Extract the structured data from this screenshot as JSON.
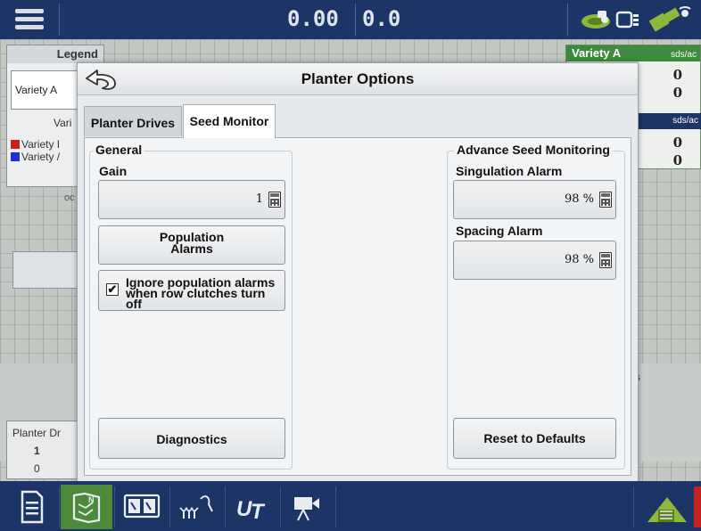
{
  "topbar": {
    "readout_left": "0.00",
    "readout_right": "0.0",
    "icons": [
      "menu-icon",
      "field-tractor-icon",
      "connection-icon",
      "gps-satellite-icon"
    ]
  },
  "background": {
    "legend": {
      "title": "Legend",
      "button_label": "Variety A",
      "subtitle": "Vari",
      "rows": [
        {
          "label": "Variety I",
          "color": "#c42121"
        },
        {
          "label": "Variety /",
          "color": "#1d2fd4"
        }
      ],
      "small_text": "oc"
    },
    "variety_panel": {
      "title": "Variety A",
      "unit": "sds/ac",
      "values": [
        "0",
        "0"
      ],
      "unit2": "sds/ac",
      "values2": [
        "0",
        "0"
      ]
    },
    "right_fragment": "s",
    "planter_drives_panel": {
      "title": "Planter Dr",
      "value": "1",
      "subvalue": "0"
    }
  },
  "modal": {
    "title": "Planter Options",
    "tabs": [
      {
        "label": "Planter Drives",
        "active": false
      },
      {
        "label": "Seed Monitor",
        "active": true
      }
    ],
    "general": {
      "legend": "General",
      "gain_label": "Gain",
      "gain_value": "1",
      "population_alarms_line1": "Population",
      "population_alarms_line2": "Alarms",
      "ignore_checked": true,
      "ignore_label": "Ignore population alarms when row clutches turn off",
      "diagnostics_label": "Diagnostics"
    },
    "advanced": {
      "legend": "Advance Seed Monitoring",
      "singulation_label": "Singulation Alarm",
      "singulation_value": "98 %",
      "spacing_label": "Spacing Alarm",
      "spacing_value": "98 %",
      "reset_label": "Reset to Defaults"
    }
  },
  "bottombar": {
    "buttons": [
      "document-icon",
      "field-map-icon",
      "split-view-icon",
      "seed-plants-icon",
      "ut-icon",
      "camera-icon"
    ],
    "selected": "field-map-icon",
    "accent": "#4c8a3a"
  }
}
